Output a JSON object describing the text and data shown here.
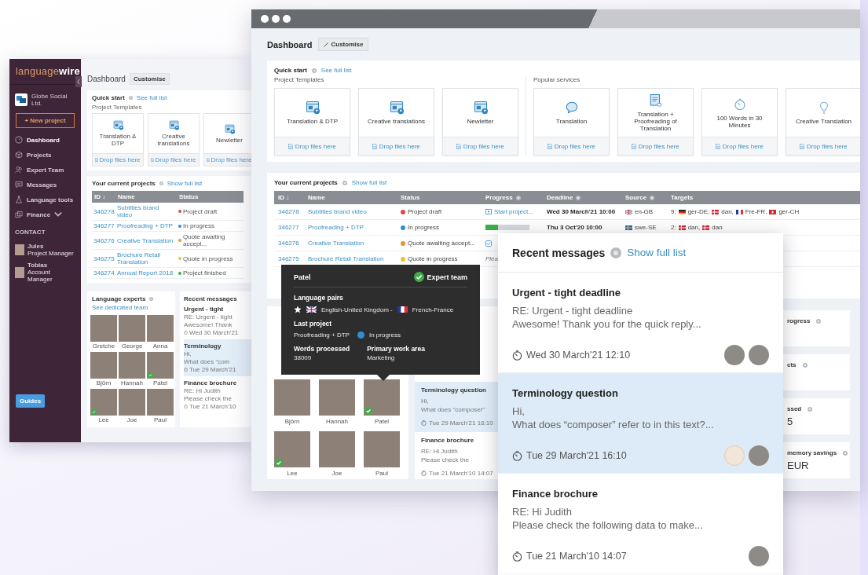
{
  "back_window": {
    "logo": "language**wire**",
    "company": "Globe Social Ltd.",
    "new_project": "+ New project",
    "nav": [
      {
        "label": "Dashboard",
        "kind": "gauge",
        "selected": true
      },
      {
        "label": "Projects",
        "kind": "box",
        "selected": false
      },
      {
        "label": "Expert Team",
        "kind": "people",
        "selected": false
      },
      {
        "label": "Messages",
        "kind": "chat",
        "selected": false
      },
      {
        "label": "Language tools",
        "kind": "flask",
        "selected": false
      },
      {
        "label": "Finance",
        "kind": "coins",
        "selected": false,
        "expandable": true
      }
    ],
    "contact_heading": "CONTACT",
    "contacts": [
      {
        "name": "Jules",
        "role": "Project Manager"
      },
      {
        "name": "Tobias",
        "role": "Account Manager"
      }
    ],
    "guides": "Guides",
    "page_title": "Dashboard",
    "customise": "Customise",
    "quick_start": {
      "title": "Quick start",
      "link": "See full list",
      "section": "Project Templates",
      "cards": [
        {
          "label": "Translation & DTP",
          "drop": "Drop files here"
        },
        {
          "label": "Creative translations",
          "drop": "Drop files here"
        },
        {
          "label": "Newletter",
          "drop": "Drop files here"
        }
      ]
    },
    "projects": {
      "title": "Your current projects",
      "link": "Show full list",
      "columns": [
        "ID ↓",
        "Name",
        "Status"
      ],
      "rows": [
        {
          "id": "346278",
          "name": "Subtitles brand video",
          "status": "Project draft",
          "color": "#e04848"
        },
        {
          "id": "346277",
          "name": "Proofreading + DTP",
          "status": "In progress",
          "color": "#2e8fd6"
        },
        {
          "id": "346276",
          "name": "Creative Translation",
          "status": "Quote awaiting accept...",
          "color": "#e8952f"
        },
        {
          "id": "346275",
          "name": "Brochure Retail Translation",
          "status": "Quote in progress",
          "color": "#f0c02a"
        },
        {
          "id": "346274",
          "name": "Annual Report 2018",
          "status": "Project finished",
          "color": "#3cb34a"
        }
      ]
    },
    "experts": {
      "title": "Language experts",
      "link": "See dedicated team",
      "people": [
        {
          "name": "Gretche",
          "verified": false
        },
        {
          "name": "George",
          "verified": false
        },
        {
          "name": "Anna",
          "verified": false
        },
        {
          "name": "Björn",
          "verified": false
        },
        {
          "name": "Hannah",
          "verified": false
        },
        {
          "name": "Patel",
          "verified": true
        },
        {
          "name": "Lee",
          "verified": true
        },
        {
          "name": "Joe",
          "verified": false
        },
        {
          "name": "Paul",
          "verified": false
        }
      ]
    },
    "messages": {
      "title": "Recent messages",
      "items": [
        {
          "subject": "Urgent - tight",
          "line1": "RE: Urgent - tight",
          "line2": "Awesome! Thank",
          "time": "Wed 30 March'21",
          "selected": false
        },
        {
          "subject": "Terminology",
          "line1": "Hi,",
          "line2": "What does “com",
          "time": "Tue 29 March'21",
          "selected": true
        },
        {
          "subject": "Finance brochure",
          "line1": "RE: Hi Judith",
          "line2": "Please check the",
          "time": "Tue 21 March'10",
          "selected": false
        }
      ]
    }
  },
  "main_window": {
    "page_title": "Dashboard",
    "customise": "Customise",
    "quick_start": {
      "title": "Quick start",
      "link": "See full list",
      "groups": [
        {
          "title": "Project Templates",
          "cards": [
            {
              "label": "Translation & DTP",
              "kind": "template",
              "drop": "Drop files here"
            },
            {
              "label": "Creative translations",
              "kind": "template",
              "drop": "Drop files here"
            },
            {
              "label": "Newletter",
              "kind": "template",
              "drop": "Drop files here"
            }
          ]
        },
        {
          "title": "Popular services",
          "cards": [
            {
              "label": "Translation",
              "kind": "chat",
              "drop": "Drop files here"
            },
            {
              "label": "Translation + Proofreading of Translation",
              "kind": "document",
              "drop": "Drop files here"
            },
            {
              "label": "100 Words in 30 Minutes",
              "kind": "timer",
              "drop": "Drop files here"
            },
            {
              "label": "Creative Translation",
              "kind": "bulb",
              "drop": "Drop files here"
            }
          ]
        }
      ]
    },
    "projects": {
      "title": "Your current projects",
      "link": "Show full list",
      "columns": [
        {
          "label": "ID ↓",
          "help": false
        },
        {
          "label": "Name",
          "help": false
        },
        {
          "label": "Status",
          "help": false
        },
        {
          "label": "Progress",
          "help": true
        },
        {
          "label": "Deadline",
          "help": true
        },
        {
          "label": "Source",
          "help": true
        },
        {
          "label": "Targets",
          "help": false
        }
      ],
      "rows": [
        {
          "id": "346278",
          "name": "Subtitles brand video",
          "status": "Project draft",
          "color": "#e04848",
          "progress": {
            "kind": "action",
            "label": "Start project..."
          },
          "deadline": "Wed 30 March'21 10:00",
          "source": {
            "kind": "gb",
            "code": "en-GB"
          },
          "targets": {
            "count": "9:",
            "langs": [
              {
                "kind": "de",
                "code": "ger-DE,"
              },
              {
                "kind": "dk",
                "code": "dan,"
              },
              {
                "kind": "fr",
                "code": "Fre-FR,"
              },
              {
                "kind": "ch",
                "code": "ger-CH"
              }
            ]
          }
        },
        {
          "id": "346277",
          "name": "Proofreading + DTP",
          "status": "In progress",
          "color": "#2e8fd6",
          "progress": {
            "kind": "bar",
            "level": 0.28
          },
          "deadline": "Thu 3 Oct'20 10:00",
          "source": {
            "kind": "se",
            "code": "swe-SE"
          },
          "targets": {
            "count": "2:",
            "langs": [
              {
                "kind": "dk",
                "code": "dan,"
              },
              {
                "kind": "dk",
                "code": "dan"
              }
            ]
          }
        },
        {
          "id": "346276",
          "name": "Creative Translation",
          "status": "Quote awaiting accept...",
          "color": "#e8952f",
          "progress": {
            "kind": "icon"
          }
        },
        {
          "id": "346275",
          "name": "Brochure Retail Translation",
          "status": "Quote in progress",
          "color": "#f0c02a",
          "progress": {
            "kind": "text",
            "label": "Plea"
          }
        }
      ]
    },
    "experts": {
      "people": [
        {
          "name": "Björn",
          "verified": false
        },
        {
          "name": "Hannah",
          "verified": false
        },
        {
          "name": "Patel",
          "verified": true
        },
        {
          "name": "Lee",
          "verified": true
        },
        {
          "name": "Joe",
          "verified": false
        },
        {
          "name": "Paul",
          "verified": false
        }
      ]
    },
    "messages": {
      "items": [
        {
          "subject": "Terminology question",
          "line1": "Hi,",
          "line2": "What does “composer”",
          "time": "Tue 29 March'21 16:10",
          "selected": true
        },
        {
          "subject": "Finance brochure",
          "line1": "RE: Hi Judith",
          "line2": "Please check the",
          "time": "Tue 21 March'10 14:07",
          "selected": false
        }
      ]
    },
    "stats": [
      {
        "label": "rogress"
      },
      {
        "label": "cts"
      },
      {
        "label": "ssed",
        "value": "5"
      },
      {
        "label": "memory savings",
        "value": "EUR"
      }
    ]
  },
  "tooltip": {
    "name": "Patel",
    "badge": "Expert team",
    "pairs_title": "Language pairs",
    "favourite": true,
    "from": {
      "kind": "gb",
      "label": "English-United Kingdom -"
    },
    "to": {
      "kind": "fr",
      "label": "French-France"
    },
    "last_title": "Last project",
    "last_project": "Proofreading + DTP",
    "last_status": {
      "label": "In progress",
      "color": "#2e8fd6"
    },
    "words_title": "Words processed",
    "words": "38009",
    "area_title": "Primary work area",
    "area": "Marketing"
  },
  "messages_panel": {
    "title": "Recent messages",
    "link": "Show full list",
    "items": [
      {
        "subject": "Urgent - tight deadline",
        "line1": "RE: Urgent - tight deadline",
        "line2": "Awesome! Thank you for the quick reply...",
        "time": "Wed 30 March'21 12:10",
        "selected": false,
        "avatars": [
          {
            "kind": "photo"
          },
          {
            "kind": "photo"
          }
        ]
      },
      {
        "subject": "Terminology question",
        "line1": "Hi,",
        "line2": "What does “composer” refer to in this text?...",
        "time": "Tue 29 March'21 16:10",
        "selected": true,
        "avatars": [
          {
            "kind": "sketch"
          },
          {
            "kind": "photo"
          }
        ]
      },
      {
        "subject": "Finance brochure",
        "line1": "RE: Hi Judith",
        "line2": "Please check the following data to make...",
        "time": "Tue 21 March'10 14:07",
        "selected": false,
        "avatars": [
          {
            "kind": "photo"
          }
        ]
      }
    ]
  }
}
